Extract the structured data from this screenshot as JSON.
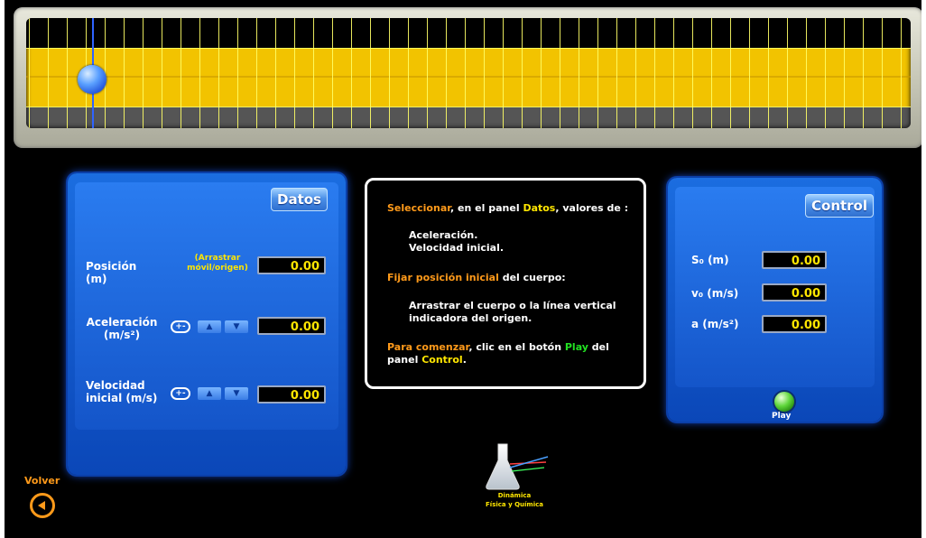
{
  "datos": {
    "title": "Datos",
    "posicion_label": "Posición (m)",
    "drag_hint": "(Arrastrar móvil/origen)",
    "posicion_value": "0.00",
    "aceleracion_label": "Aceleración (m/s²)",
    "aceleracion_value": "0.00",
    "velocidad_label": "Velocidad inicial (m/s)",
    "velocidad_value": "0.00",
    "plusminus_glyph": "+-",
    "up_glyph": "▲",
    "down_glyph": "▼"
  },
  "instructions": {
    "line1_orange": "Seleccionar",
    "line1_mid": ", en el panel ",
    "line1_yellow": "Datos",
    "line1_end": ", valores de :",
    "item1": "Aceleración.",
    "item2": "Velocidad inicial.",
    "line2_orange": "Fijar posición inicial",
    "line2_end": " del cuerpo:",
    "line3a": "Arrastrar el cuerpo o la línea vertical",
    "line3b": "indicadora del origen.",
    "line4_orange": "Para comenzar",
    "line4_mid": ", clic en el botón ",
    "line4_green": "Play",
    "line4_end": " del",
    "line5_start": "panel ",
    "line5_yellow": "Control",
    "line5_end": "."
  },
  "control": {
    "title": "Control",
    "s0_label": "S₀ (m)",
    "s0_value": "0.00",
    "v0_label": "v₀ (m/s)",
    "v0_value": "0.00",
    "a_label": "a (m/s²)",
    "a_value": "0.00",
    "play_label": "Play"
  },
  "nav": {
    "volver_label": "Volver"
  },
  "logo": {
    "line1": "Dinámica",
    "line2": "Física y Química"
  },
  "colors": {
    "track_yellow": "#f2c300",
    "panel_blue": "#1b6de0",
    "value_yellow": "#ffe600",
    "accent_orange": "#ff9a1a",
    "play_green": "#22e022"
  }
}
